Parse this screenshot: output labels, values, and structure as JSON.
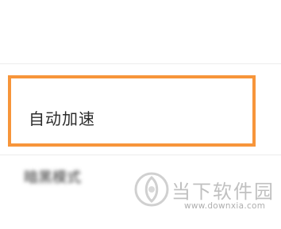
{
  "settings_list": {
    "items": [
      {
        "label": "",
        "blurred": true
      },
      {
        "label": "自动加速",
        "highlighted": true
      },
      {
        "label": "暗黑模式",
        "blurred": true
      }
    ]
  },
  "highlight": {
    "border_color": "#f7953a"
  },
  "watermark": {
    "title": "当下软件园",
    "url": "www.downxia.com",
    "logo_icon": "downxia-logo-icon"
  }
}
